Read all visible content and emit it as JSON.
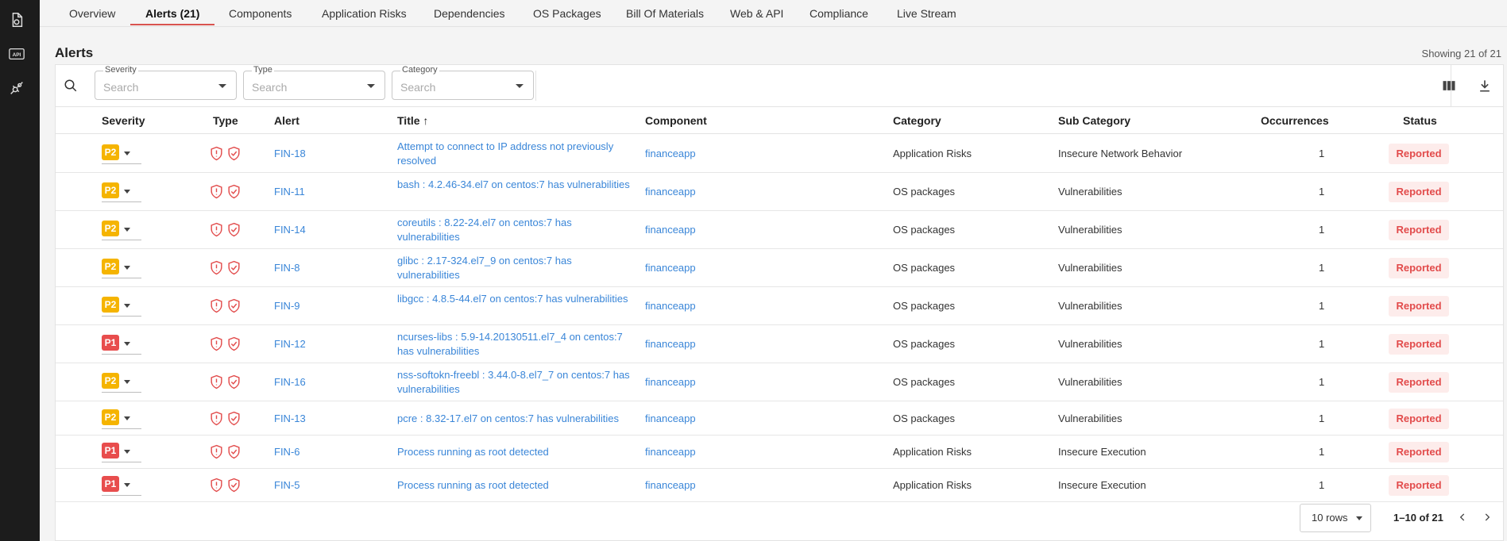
{
  "sidebar": {
    "icons": [
      "document-icon",
      "api-icon",
      "integration-icon"
    ],
    "api_label": "API"
  },
  "tabs": [
    {
      "label": "Overview",
      "active": false
    },
    {
      "label": "Alerts (21)",
      "active": true
    },
    {
      "label": "Components",
      "active": false
    },
    {
      "label": "Application Risks",
      "active": false
    },
    {
      "label": "Dependencies",
      "active": false
    },
    {
      "label": "OS Packages",
      "active": false
    },
    {
      "label": "Bill Of Materials",
      "active": false
    },
    {
      "label": "Web & API",
      "active": false
    },
    {
      "label": "Compliance",
      "active": false
    },
    {
      "label": "Live Stream",
      "active": false
    }
  ],
  "section": {
    "title": "Alerts",
    "showing": "Showing 21 of 21"
  },
  "filters": [
    {
      "label": "Severity",
      "placeholder": "Search"
    },
    {
      "label": "Type",
      "placeholder": "Search"
    },
    {
      "label": "Category",
      "placeholder": "Search"
    }
  ],
  "columns": {
    "severity": "Severity",
    "type": "Type",
    "alert": "Alert",
    "title": "Title",
    "title_sort": "↑",
    "component": "Component",
    "category": "Category",
    "sub_category": "Sub Category",
    "occurrences": "Occurrences",
    "status": "Status"
  },
  "rows": [
    {
      "severity": "P2",
      "alert": "FIN-18",
      "title": "Attempt to connect to IP address not previously resolved",
      "component": "financeapp",
      "category": "Application Risks",
      "sub_category": "Insecure Network Behavior",
      "occurrences": "1",
      "status": "Reported"
    },
    {
      "severity": "P2",
      "alert": "FIN-11",
      "title": "bash : 4.2.46-34.el7 on centos:7 has vulnerabilities",
      "component": "financeapp",
      "category": "OS packages",
      "sub_category": "Vulnerabilities",
      "occurrences": "1",
      "status": "Reported"
    },
    {
      "severity": "P2",
      "alert": "FIN-14",
      "title": "coreutils : 8.22-24.el7 on centos:7 has vulnerabilities",
      "component": "financeapp",
      "category": "OS packages",
      "sub_category": "Vulnerabilities",
      "occurrences": "1",
      "status": "Reported"
    },
    {
      "severity": "P2",
      "alert": "FIN-8",
      "title": "glibc : 2.17-324.el7_9 on centos:7 has vulnerabilities",
      "component": "financeapp",
      "category": "OS packages",
      "sub_category": "Vulnerabilities",
      "occurrences": "1",
      "status": "Reported"
    },
    {
      "severity": "P2",
      "alert": "FIN-9",
      "title": "libgcc : 4.8.5-44.el7 on centos:7 has vulnerabilities",
      "component": "financeapp",
      "category": "OS packages",
      "sub_category": "Vulnerabilities",
      "occurrences": "1",
      "status": "Reported"
    },
    {
      "severity": "P1",
      "alert": "FIN-12",
      "title": "ncurses-libs : 5.9-14.20130511.el7_4 on centos:7 has vulnerabilities",
      "component": "financeapp",
      "category": "OS packages",
      "sub_category": "Vulnerabilities",
      "occurrences": "1",
      "status": "Reported"
    },
    {
      "severity": "P2",
      "alert": "FIN-16",
      "title": "nss-softokn-freebl : 3.44.0-8.el7_7 on centos:7 has vulnerabilities",
      "component": "financeapp",
      "category": "OS packages",
      "sub_category": "Vulnerabilities",
      "occurrences": "1",
      "status": "Reported"
    },
    {
      "severity": "P2",
      "alert": "FIN-13",
      "title": "pcre : 8.32-17.el7 on centos:7 has vulnerabilities",
      "component": "financeapp",
      "category": "OS packages",
      "sub_category": "Vulnerabilities",
      "occurrences": "1",
      "status": "Reported"
    },
    {
      "severity": "P1",
      "alert": "FIN-6",
      "title": "Process running as root detected",
      "component": "financeapp",
      "category": "Application Risks",
      "sub_category": "Insecure Execution",
      "occurrences": "1",
      "status": "Reported"
    },
    {
      "severity": "P1",
      "alert": "FIN-5",
      "title": "Process running as root detected",
      "component": "financeapp",
      "category": "Application Risks",
      "sub_category": "Insecure Execution",
      "occurrences": "1",
      "status": "Reported"
    }
  ],
  "pagination": {
    "rows_per_page": "10 rows",
    "range": "1–10 of 21"
  },
  "colors": {
    "p1": "#e84d4d",
    "p2": "#f5b400",
    "link": "#3a86d8",
    "status": "#e24b4b",
    "type_icon": "#e24b4b",
    "tab_accent": "#d9534f"
  }
}
